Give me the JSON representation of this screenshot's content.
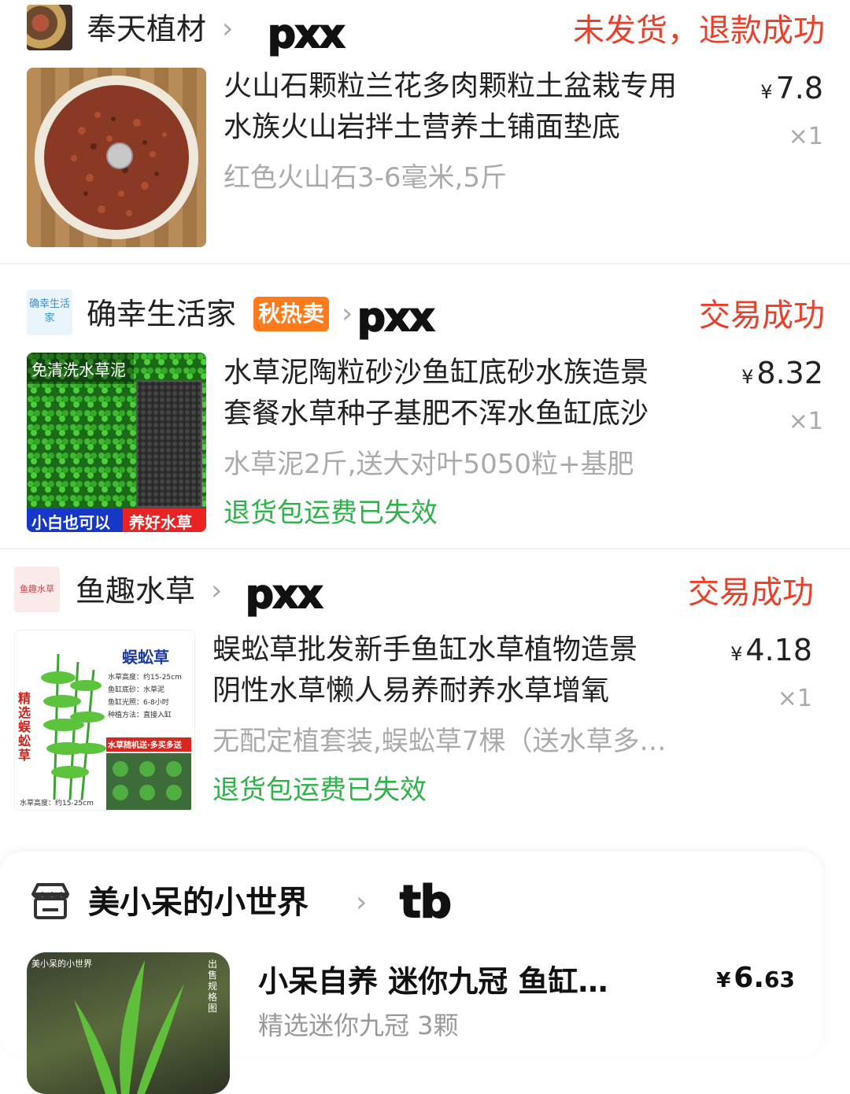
{
  "orders": [
    {
      "shop_name": "奉天植材",
      "tag": "pxx",
      "status": "未发货，退款成功",
      "title_line1": "火山石颗粒兰花多肉颗粒土盆栽专用",
      "title_line2": "水族火山岩拌土营养土铺面垫底",
      "variant": "红色火山石3-6毫米,5斤",
      "price_currency": "¥",
      "price_value": "7.8",
      "quantity": "×1"
    },
    {
      "shop_name": "确幸生活家",
      "shop_avatar_text": "确幸生活家",
      "badge": "秋热卖",
      "tag": "pxx",
      "status": "交易成功",
      "title_line1": "水草泥陶粒砂沙鱼缸底砂水族造景",
      "title_line2": "套餐水草种子基肥不浑水鱼缸底沙",
      "variant": "水草泥2斤,送大对叶5050粒+基肥",
      "price_currency": "¥",
      "price_value": "8.32",
      "quantity": "×1",
      "note": "退货包运费已失效",
      "thumb_top_label": "免清洗水草泥",
      "thumb_bottom_left": "小白也可以",
      "thumb_bottom_right": "养好水草"
    },
    {
      "shop_name": "鱼趣水草",
      "shop_avatar_text": "鱼趣水草",
      "tag": "pxx",
      "status": "交易成功",
      "title_line1": "蜈蚣草批发新手鱼缸水草植物造景",
      "title_line2": "阴性水草懒人易养耐养水草增氧",
      "variant": "无配定植套装,蜈蚣草7棵（送水草多…",
      "price_currency": "¥",
      "price_value": "4.18",
      "quantity": "×1",
      "note": "退货包运费已失效",
      "thumb_title": "蜈蚣草",
      "thumb_side": "精选蜈蚣草",
      "thumb_specs": [
        "水草高度：约15-25cm",
        "鱼缸底砂：水草泥",
        "鱼缸光照：6-8小时",
        "种植方法：直接入缸"
      ],
      "thumb_banner": "水草随机送·多买多送",
      "thumb_footer": "水草高度：约15-25cm"
    },
    {
      "shop_name": "美小呆的小世界",
      "tag": "tb",
      "title": "小呆自养 迷你九冠 鱼缸…",
      "variant": "精选迷你九冠 3颗",
      "price_currency": "¥",
      "price_int": "6.",
      "price_dec": "63",
      "thumb_label": "美小呆的小世界",
      "thumb_side": "出售规格图"
    }
  ],
  "colors": {
    "status_red": "#e8402a",
    "note_green": "#2fb24a",
    "badge_orange": "#ff7a1a",
    "muted_gray": "#aaaaaa"
  }
}
